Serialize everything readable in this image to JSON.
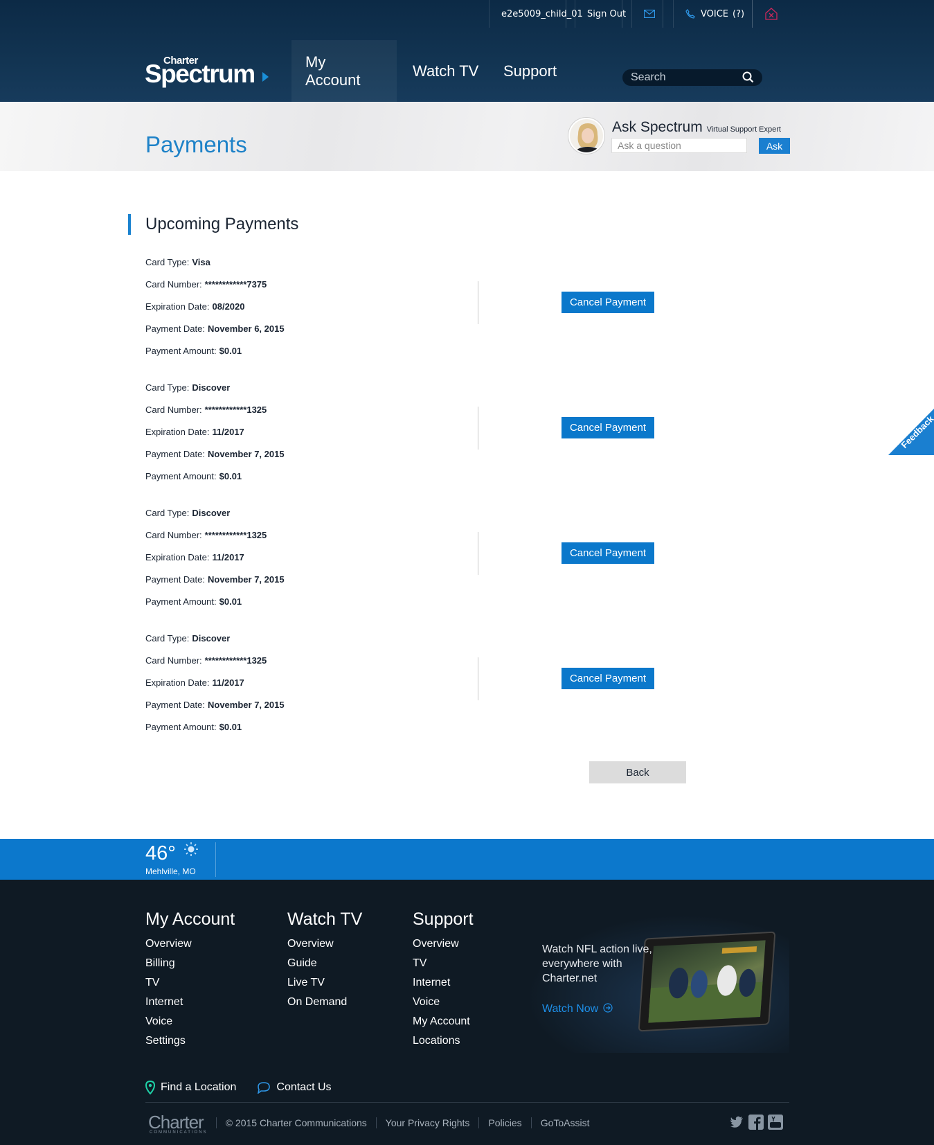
{
  "utility": {
    "username": "e2e5009_child_01",
    "sign_out": "Sign Out",
    "voice_label": "VOICE",
    "voice_count": "(?)"
  },
  "logo": {
    "small": "Charter",
    "big": "Spectrum"
  },
  "nav": {
    "my_account": "My Account",
    "watch_tv": "Watch TV",
    "support": "Support"
  },
  "search": {
    "placeholder": "Search"
  },
  "page": {
    "title": "Payments"
  },
  "ask": {
    "title": "Ask Spectrum",
    "subtitle": "Virtual Support Expert",
    "placeholder": "Ask a question",
    "button": "Ask"
  },
  "section": {
    "title": "Upcoming Payments"
  },
  "labels": {
    "card_type": "Card Type:",
    "card_number": "Card Number:",
    "expiration": "Expiration Date:",
    "payment_date": "Payment Date:",
    "amount": "Payment Amount:",
    "cancel": "Cancel Payment"
  },
  "payments": [
    {
      "card_type": "Visa",
      "card_number": "************7375",
      "expiration": "08/2020",
      "payment_date": "November 6, 2015",
      "amount": "$0.01"
    },
    {
      "card_type": "Discover",
      "card_number": "************1325",
      "expiration": "11/2017",
      "payment_date": "November 7, 2015",
      "amount": "$0.01"
    },
    {
      "card_type": "Discover",
      "card_number": "************1325",
      "expiration": "11/2017",
      "payment_date": "November 7, 2015",
      "amount": "$0.01"
    },
    {
      "card_type": "Discover",
      "card_number": "************1325",
      "expiration": "11/2017",
      "payment_date": "November 7, 2015",
      "amount": "$0.01"
    }
  ],
  "back_button": "Back",
  "feedback": "Feedback",
  "weather": {
    "temp": "46°",
    "location": "Mehlville, MO"
  },
  "footer": {
    "my_account": {
      "title": "My Account",
      "links": [
        "Overview",
        "Billing",
        "TV",
        "Internet",
        "Voice",
        "Settings"
      ]
    },
    "watch_tv": {
      "title": "Watch TV",
      "links": [
        "Overview",
        "Guide",
        "Live TV",
        "On Demand"
      ]
    },
    "support": {
      "title": "Support",
      "links": [
        "Overview",
        "TV",
        "Internet",
        "Voice",
        "My Account",
        "Locations"
      ]
    },
    "promo": {
      "text": "Watch NFL action live, everywhere with Charter.net",
      "link": "Watch Now"
    },
    "find_location": "Find a Location",
    "contact_us": "Contact Us",
    "charter_logo": "Charter",
    "charter_logo_sub": "COMMUNICATIONS",
    "copyright": "© 2015 Charter Communications",
    "privacy": "Your Privacy Rights",
    "policies": "Policies",
    "gotoassist": "GoToAssist"
  },
  "colors": {
    "accent": "#0b78cb",
    "header": "#123452",
    "footer": "#0f1a24"
  }
}
